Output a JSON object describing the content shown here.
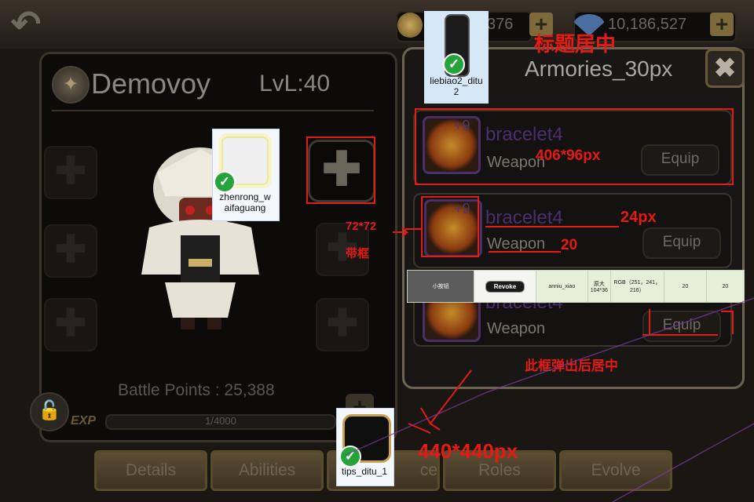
{
  "top_bar": {
    "back_label": "↶",
    "coin_value": "376",
    "gem_value": "10,186,527",
    "plus_label": "+"
  },
  "hero": {
    "emblem_glyph": "✦",
    "name": "Demovoy",
    "level": "LvL:40",
    "battle_points": "Battle Points : 25,388",
    "exp_label": "EXP",
    "exp_progress": "1/4000",
    "exp_fraction": 0.00025,
    "slot_glyph": "✚",
    "lock_glyph": "🔓"
  },
  "tabs": [
    {
      "label": "Details"
    },
    {
      "label": "Abilities"
    },
    {
      "label": "ce"
    },
    {
      "label": "Roles"
    },
    {
      "label": "Evolve"
    }
  ],
  "armory": {
    "title": "Armories_30px",
    "close_label": "✖",
    "items": [
      {
        "plus": "+9",
        "name": "bracelet4",
        "type": "Weapon",
        "button": "Equip"
      },
      {
        "plus": "+9",
        "name": "bracelet4",
        "type": "Weapon",
        "button": "Equip"
      },
      {
        "plus": "",
        "name": "bracelet4",
        "type": "Weapon",
        "button": "Equip"
      }
    ]
  },
  "spec_table": {
    "cells": [
      "小按钮",
      "Revoke",
      "anniu_xiao",
      "原大\n104*36",
      "RGB（251，241，216）",
      "20",
      "20"
    ]
  },
  "assets": {
    "liebiao": "liebiao2_ditu\n2",
    "zhenrong": "zhenrong_w\naifaguang",
    "tips": "tips_ditu_1",
    "check_glyph": "✓"
  },
  "annotations": {
    "title_center": "标题居中",
    "row_size": "406*96px",
    "name_size": "24px",
    "type_size": "20",
    "icon_size": "72*72",
    "icon_frame": "带框",
    "popup_center": "此框弹出后居中",
    "panel_size": "440*440px"
  },
  "colors": {
    "annotation_red": "#e41a14",
    "item_name_purple": "#4a2f6e",
    "panel_border": "#6b6452"
  }
}
